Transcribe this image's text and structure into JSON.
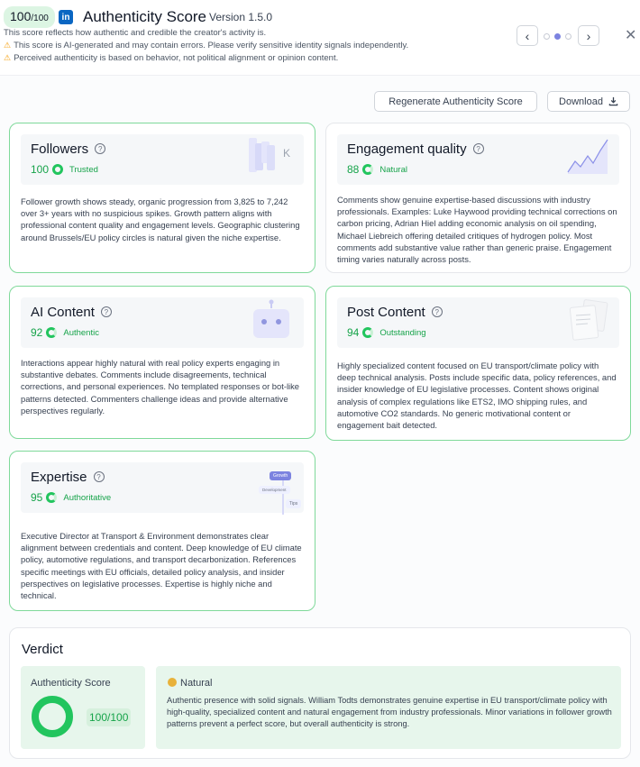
{
  "header": {
    "score_value": "100",
    "score_max": "/100",
    "network_icon": "linkedin-icon",
    "title": "Authenticity Score",
    "version": "Version 1.5.0",
    "notes": [
      "This score reflects how authentic and credible the creator's activity is.",
      "This score is AI-generated and may contain errors. Please verify sensitive identity signals independently.",
      "Perceived authenticity is based on behavior, not political alignment or opinion content."
    ],
    "nav_prev": "‹",
    "nav_next": "›",
    "close": "✕"
  },
  "toolbar": {
    "regenerate_label": "Regenerate Authenticity Score",
    "download_label": "Download"
  },
  "cards": {
    "followers": {
      "title": "Followers",
      "score": "100",
      "level": "Trusted",
      "illustration_suffix": "K",
      "text": "Follower growth shows steady, organic progression from 3,825 to 7,242 over 3+ years with no suspicious spikes. Growth pattern aligns with professional content quality and engagement levels. Geographic clustering around Brussels/EU policy circles is natural given the niche expertise."
    },
    "engagement": {
      "title": "Engagement quality",
      "score": "88",
      "level": "Natural",
      "text": "Comments show genuine expertise-based discussions with industry professionals. Examples: Luke Haywood providing technical corrections on carbon pricing, Adrian Hiel adding economic analysis on oil spending, Michael Liebreich offering detailed critiques of hydrogen policy. Most comments add substantive value rather than generic praise. Engagement timing varies naturally across posts."
    },
    "ai_content": {
      "title": "AI Content",
      "score": "92",
      "level": "Authentic",
      "text": "Interactions appear highly natural with real policy experts engaging in substantive debates. Comments include disagreements, technical corrections, and personal experiences. No templated responses or bot-like patterns detected. Commenters challenge ideas and provide alternative perspectives regularly."
    },
    "post_content": {
      "title": "Post Content",
      "score": "94",
      "level": "Outstanding",
      "text": "Highly specialized content focused on EU transport/climate policy with deep technical analysis. Posts include specific data, policy references, and insider knowledge of EU legislative processes. Content shows original analysis of complex regulations like ETS2, IMO shipping rules, and automotive CO2 standards. No generic motivational content or engagement bait detected."
    },
    "expertise": {
      "title": "Expertise",
      "score": "95",
      "level": "Authoritative",
      "illustration_labels": [
        "Growth",
        "Development",
        "Tips"
      ],
      "text": "Executive Director at Transport & Environment demonstrates clear alignment between credentials and content. Deep knowledge of EU climate policy, automotive regulations, and transport decarbonization. References specific meetings with EU officials, detailed policy analysis, and insider perspectives on legislative processes. Expertise is highly niche and technical."
    }
  },
  "verdict": {
    "title": "Verdict",
    "score_label": "Authenticity Score",
    "score_display": "100/100",
    "score_fraction": 1.0,
    "level": "Natural",
    "text": "Authentic presence with solid signals. William Todts demonstrates genuine expertise in EU transport/climate policy with high-quality, specialized content and natural engagement from industry professionals. Minor variations in follower growth patterns prevent a perfect score, but overall authenticity is strong."
  },
  "colors": {
    "accent_green": "#22c55e",
    "border_green": "#7fd99a",
    "pill_bg": "#dcf5e3",
    "linkedin_blue": "#0a66c2",
    "pager_active": "#7c83e0"
  }
}
